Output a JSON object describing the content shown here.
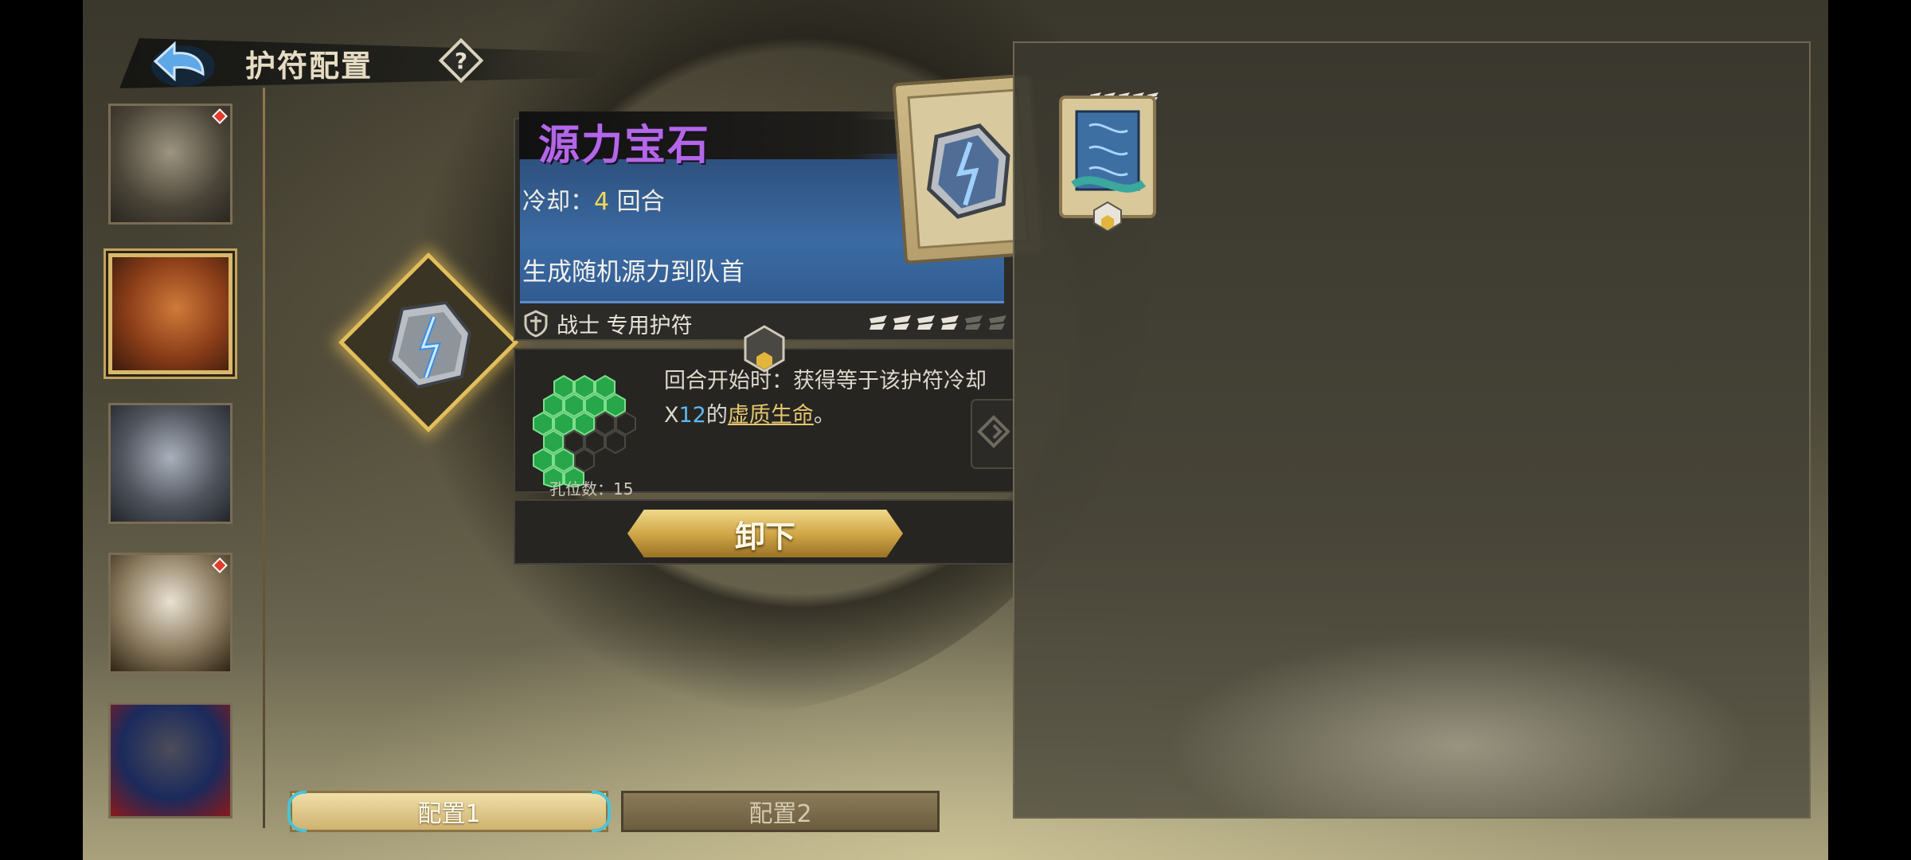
{
  "header": {
    "title": "护符配置"
  },
  "item": {
    "name": "源力宝石",
    "cooldown_label": "冷却：",
    "cooldown_value": "4",
    "cooldown_unit": " 回合",
    "effect": "生成随机源力到队首",
    "class_label": "战士 专用护符",
    "stars_filled": 4,
    "stars_total": 6
  },
  "slot_info": {
    "text_prefix": "回合开始时：获得等于该护符冷却X",
    "highlight": "12",
    "text_mid": "的",
    "link": "虚质生命",
    "text_suffix": "。",
    "slot_count": "孔位数：15"
  },
  "actions": {
    "unequip": "卸下"
  },
  "tabs": [
    {
      "label": "配置1",
      "active": true
    },
    {
      "label": "配置2",
      "active": false
    }
  ],
  "roster": [
    {
      "name": "beast-warrior",
      "badge": true,
      "selected": false
    },
    {
      "name": "flame-warrior",
      "badge": false,
      "selected": true
    },
    {
      "name": "armored-knight",
      "badge": false,
      "selected": false
    },
    {
      "name": "white-hair-girl",
      "badge": true,
      "selected": false
    },
    {
      "name": "masked-figure",
      "badge": false,
      "selected": false
    }
  ],
  "colors": {
    "title_purple": "#b367e8",
    "cooldown_yellow": "#f1d85a",
    "highlight_blue": "#5fb8ef",
    "link_gold": "#e5c66d",
    "accent_gold": "#d8b86a"
  }
}
